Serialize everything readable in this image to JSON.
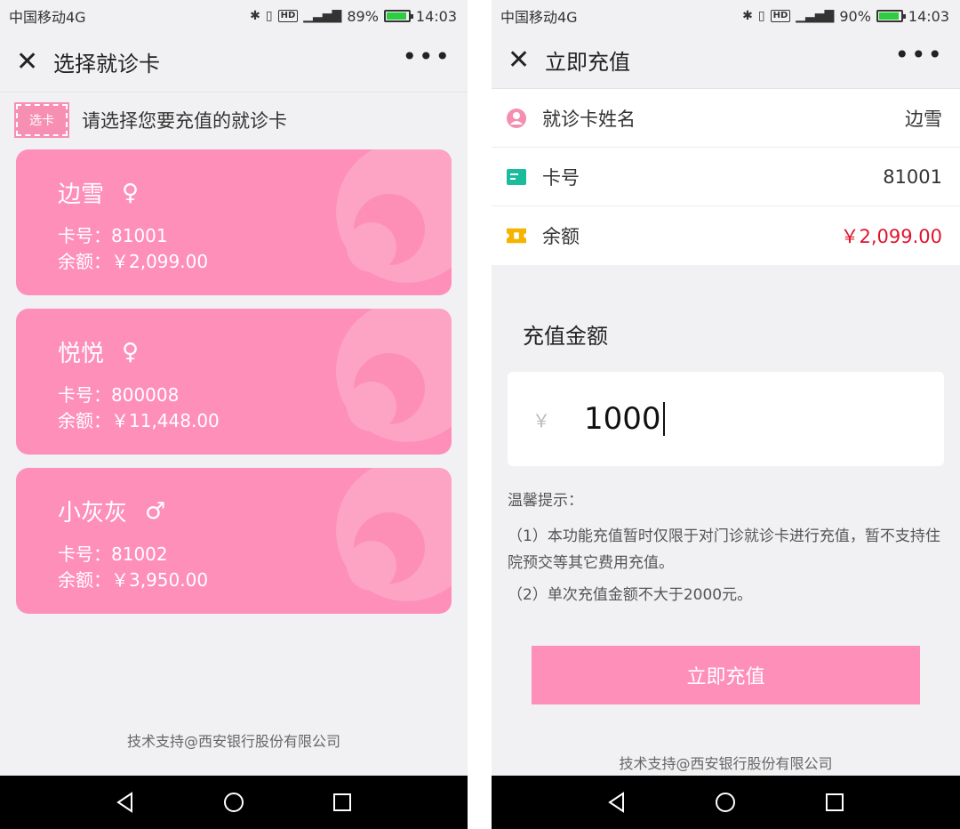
{
  "left": {
    "status": {
      "carrier": "中国移动4G",
      "battery": "89%",
      "time": "14:03"
    },
    "nav": {
      "title": "选择就诊卡"
    },
    "select": {
      "tag": "选卡",
      "prompt": "请选择您要充值的就诊卡"
    },
    "cards": [
      {
        "name": "边雪",
        "gender": "♀",
        "card_line": "卡号：81001",
        "balance_line": "余额：￥2,099.00"
      },
      {
        "name": "悦悦",
        "gender": "♀",
        "card_line": "卡号：800008",
        "balance_line": "余额：￥11,448.00"
      },
      {
        "name": "小灰灰",
        "gender": "♂",
        "card_line": "卡号：81002",
        "balance_line": "余额：￥3,950.00"
      }
    ],
    "footer": "技术支持@西安银行股份有限公司"
  },
  "right": {
    "status": {
      "carrier": "中国移动4G",
      "battery": "90%",
      "time": "14:03"
    },
    "nav": {
      "title": "立即充值"
    },
    "info": {
      "name_label": "就诊卡姓名",
      "name_value": "边雪",
      "card_label": "卡号",
      "card_value": "81001",
      "balance_label": "余额",
      "balance_value": "￥2,099.00"
    },
    "amount": {
      "title": "充值金额",
      "currency": "￥",
      "value": "1000"
    },
    "tips": {
      "title": "温馨提示：",
      "items": [
        "（1）本功能充值暂时仅限于对门诊就诊卡进行充值，暂不支持住院预交等其它费用充值。",
        "（2）单次充值金额不大于2000元。"
      ]
    },
    "button": "立即充值",
    "footer": "技术支持@西安银行股份有限公司"
  },
  "colors": {
    "pink": "#fd8fb8",
    "red": "#e0142c",
    "bg": "#f1f1f3"
  },
  "icons": [
    "close-icon",
    "more-icon",
    "user-icon",
    "card-icon",
    "ticket-icon",
    "back-icon",
    "home-icon",
    "recents-icon"
  ]
}
